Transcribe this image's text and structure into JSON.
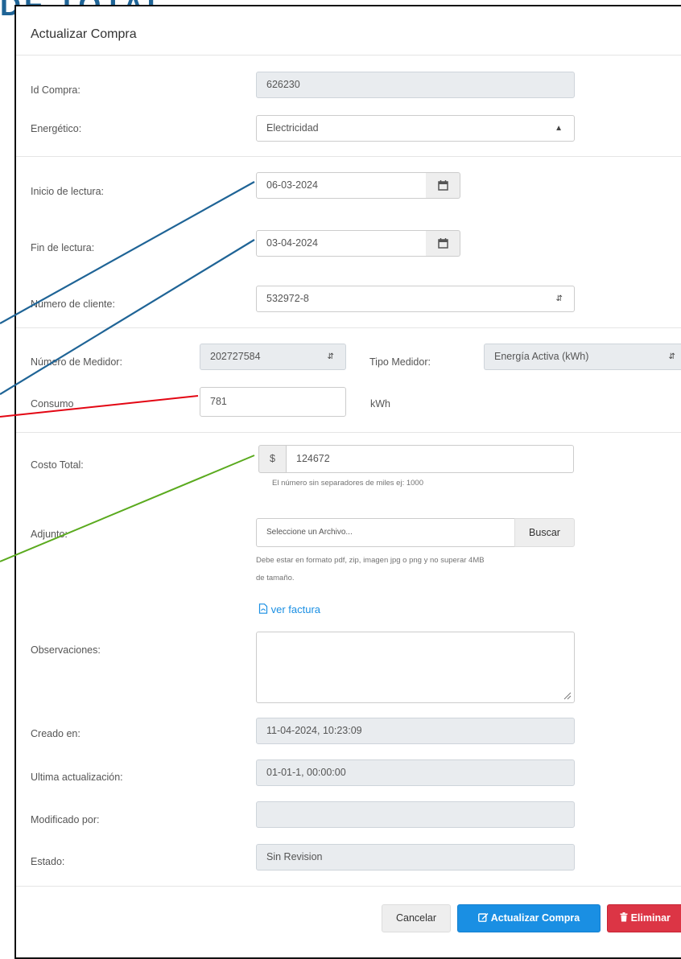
{
  "background_title": "DE TOTAL",
  "modal": {
    "title": "Actualizar Compra",
    "fields": {
      "id_compra": {
        "label": "Id Compra:",
        "value": "626230"
      },
      "energetico": {
        "label": "Energético:",
        "value": "Electricidad"
      },
      "inicio_lectura": {
        "label": "Inicio de lectura:",
        "value": "06-03-2024"
      },
      "fin_lectura": {
        "label": "Fin de lectura:",
        "value": "03-04-2024"
      },
      "numero_cliente": {
        "label": "Número de cliente:",
        "value": "532972-8"
      },
      "numero_medidor": {
        "label": "Número de Medidor:",
        "value": "202727584"
      },
      "tipo_medidor": {
        "label": "Tipo Medidor:",
        "value": "Energía Activa (kWh)"
      },
      "consumo": {
        "label": "Consumo",
        "value": "781",
        "unit": "kWh"
      },
      "costo_total": {
        "label": "Costo Total:",
        "currency": "$",
        "value": "124672",
        "help": "El número sin separadores de miles ej: 1000"
      },
      "adjunto": {
        "label": "Adjunto:",
        "placeholder": "Seleccione un Archivo...",
        "button": "Buscar",
        "help_line1": "Debe estar en formato pdf, zip, imagen jpg o png y no superar 4MB",
        "help_line2": "de tamaño.",
        "link": "ver factura"
      },
      "observaciones": {
        "label": "Observaciones:",
        "value": ""
      },
      "creado_en": {
        "label": "Creado en:",
        "value": "11-04-2024, 10:23:09"
      },
      "ultima_actualizacion": {
        "label": "Ultima actualización:",
        "value": "01-01-1, 00:00:00"
      },
      "modificado_por": {
        "label": "Modificado por:",
        "value": ""
      },
      "estado": {
        "label": "Estado:",
        "value": "Sin Revision"
      }
    },
    "buttons": {
      "cancel": "Cancelar",
      "update": "Actualizar Compra",
      "delete": "Eliminar"
    }
  },
  "colors": {
    "primary": "#1a8fe3",
    "danger": "#dc3545",
    "annotation_blue": "#1f6496",
    "annotation_red": "#e30613",
    "annotation_green": "#5aaa1e"
  },
  "icons": [
    "calendar-icon",
    "select-arrow-icon",
    "pdf-file-icon",
    "edit-icon",
    "trash-icon"
  ]
}
